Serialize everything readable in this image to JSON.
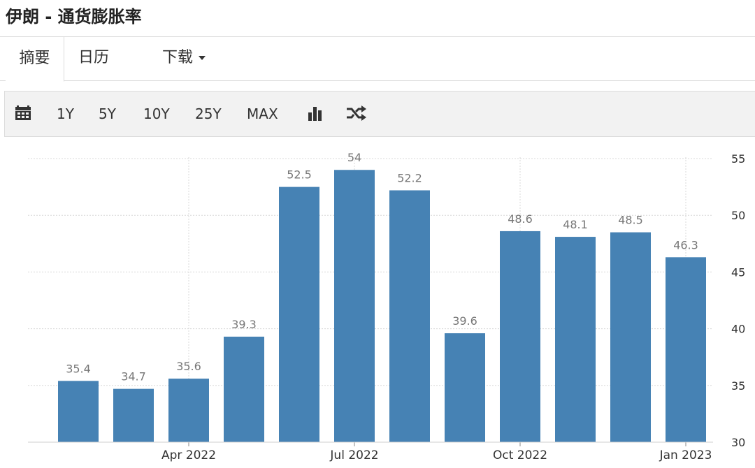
{
  "title": "伊朗 - 通货膨胀率",
  "tabs": [
    {
      "label": "摘要"
    },
    {
      "label": "日历"
    },
    {
      "label": "下载"
    }
  ],
  "toolbar": {
    "ranges": [
      "1Y",
      "5Y",
      "10Y",
      "25Y",
      "MAX"
    ],
    "icons": [
      "calendar-icon",
      "bar-chart-icon",
      "shuffle-icon"
    ]
  },
  "colors": {
    "bar": "#4682b4",
    "grid": "#d8d8d8",
    "toolbar_bg": "#f2f2f2"
  },
  "chart_data": {
    "type": "bar",
    "categories": [
      "2022-02",
      "2022-03",
      "2022-04",
      "2022-05",
      "2022-06",
      "2022-07",
      "2022-08",
      "2022-09",
      "2022-10",
      "2022-11",
      "2022-12",
      "2023-01"
    ],
    "values": [
      35.4,
      34.7,
      35.6,
      39.3,
      52.5,
      54,
      52.2,
      39.6,
      48.6,
      48.1,
      48.5,
      46.3
    ],
    "value_labels": [
      "35.4",
      "34.7",
      "35.6",
      "39.3",
      "52.5",
      "54",
      "52.2",
      "39.6",
      "48.6",
      "48.1",
      "48.5",
      "46.3"
    ],
    "x_tick_labels": [
      {
        "category": "2022-04",
        "label": "Apr 2022"
      },
      {
        "category": "2022-07",
        "label": "Jul 2022"
      },
      {
        "category": "2022-10",
        "label": "Oct 2022"
      },
      {
        "category": "2023-01",
        "label": "Jan 2023"
      }
    ],
    "y_ticks": [
      30,
      35,
      40,
      45,
      50,
      55
    ],
    "ylim": [
      30,
      55
    ],
    "y_axis_position": "right",
    "grid": true,
    "legend": "none"
  }
}
